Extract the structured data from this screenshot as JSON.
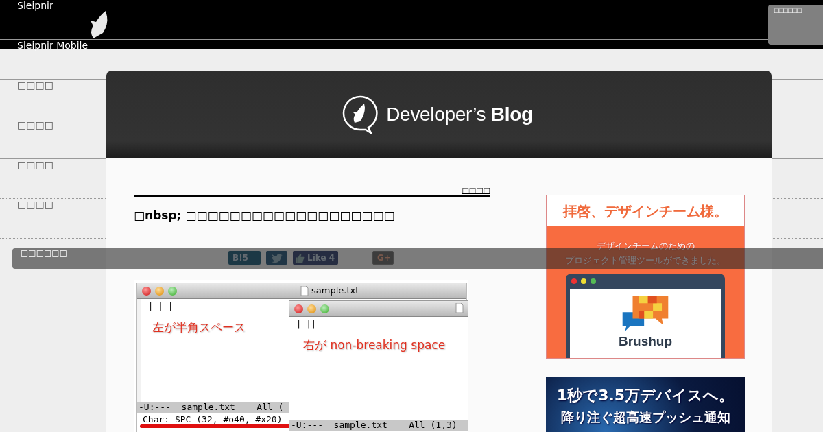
{
  "top_bar": {
    "button": "□□□□□□"
  },
  "menu": [
    {
      "label": "Sleipnir"
    },
    {
      "label": "Sleipnir Mobile"
    },
    {
      "label": "□□□□"
    },
    {
      "label": "□□□□"
    },
    {
      "label": "□□□□"
    },
    {
      "label": "□□□□"
    }
  ],
  "overlay_bar": {
    "label": "□□□□□□"
  },
  "blog_header": {
    "title_light": "Developer’s",
    "title_bold": "Blog"
  },
  "post": {
    "category": "□□□□",
    "title": "□nbsp; □□□□□□□□□□□□□□□□□□□",
    "share": [
      {
        "kind": "hatena",
        "label": "B!",
        "count": "5"
      },
      {
        "kind": "twitter"
      },
      {
        "kind": "facebook",
        "label": "Like",
        "count": "4"
      },
      {
        "kind": "gplus",
        "label": "G+"
      }
    ],
    "figure": {
      "windows": [
        {
          "title": "sample.txt",
          "text": "| |_|",
          "note": "左が半角スペース",
          "modeline": "-U:---  sample.txt    All (",
          "echo": "Char: SPC (32, #o40, #x20)"
        },
        {
          "text": "|  ||",
          "note": "右が non-breaking space",
          "modeline": "-U:---  sample.txt    All (1,3)"
        }
      ]
    }
  },
  "ads": [
    {
      "kind": "brushup",
      "headline": "拝啓、デザインチーム様。",
      "lines": [
        "デザインチームのための",
        "プロジェクト管理ツールができました。"
      ],
      "brand": "Brushup"
    },
    {
      "kind": "push",
      "lines": [
        "1秒で3.5万デバイスへ。",
        "降り注ぐ超高速プッシュ通知"
      ]
    }
  ]
}
